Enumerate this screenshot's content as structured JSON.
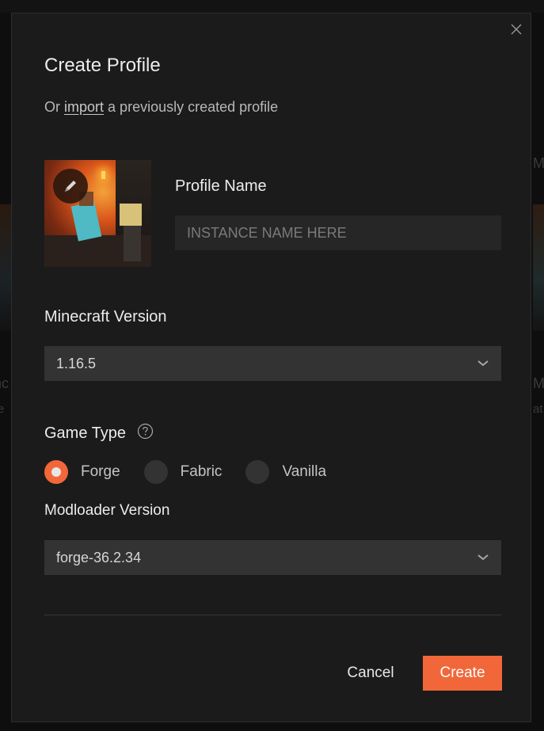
{
  "background": {
    "left_fragments": [
      "nc",
      "re"
    ],
    "right_fragments": [
      "Mo",
      "M",
      "at"
    ]
  },
  "dialog": {
    "title": "Create Profile",
    "subtitle_prefix": "Or",
    "import_link": "import",
    "subtitle_suffix": "a previously created profile",
    "close_icon": "close-icon",
    "avatar": {
      "edit_icon": "pencil-icon",
      "alt": "Minecraft cave artwork"
    },
    "profile_name": {
      "label": "Profile Name",
      "value": "",
      "placeholder": "INSTANCE NAME HERE"
    },
    "minecraft_version": {
      "label": "Minecraft Version",
      "selected": "1.16.5",
      "icon": "chevron-down-icon"
    },
    "game_type": {
      "label": "Game Type",
      "help_icon": "question-circle-icon",
      "options": [
        {
          "label": "Forge",
          "checked": true
        },
        {
          "label": "Fabric",
          "checked": false
        },
        {
          "label": "Vanilla",
          "checked": false
        }
      ]
    },
    "modloader_version": {
      "label": "Modloader Version",
      "selected": "forge-36.2.34",
      "icon": "chevron-down-icon"
    },
    "actions": {
      "cancel": "Cancel",
      "create": "Create"
    },
    "colors": {
      "accent": "#f1673a",
      "surface": "#1b1b1b",
      "field": "#333333",
      "input": "#262626"
    }
  }
}
